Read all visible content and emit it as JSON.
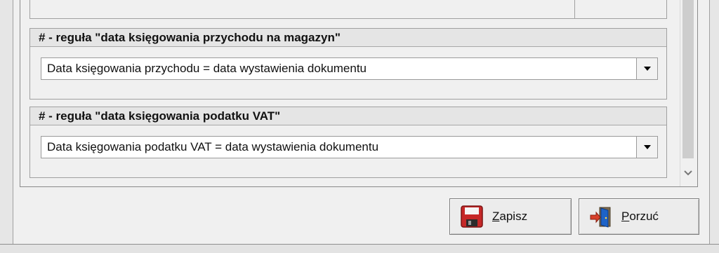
{
  "rule_groups": [
    {
      "title": "# - reguła \"data księgowania przychodu na magazyn\"",
      "selected_value": "Data księgowania przychodu = data wystawienia dokumentu"
    },
    {
      "title": "# - reguła \"data księgowania podatku VAT\"",
      "selected_value": "Data księgowania podatku VAT = data wystawienia dokumentu"
    }
  ],
  "buttons": {
    "save": {
      "mnemonic": "Z",
      "rest": "apisz",
      "icon": "floppy-disk-icon"
    },
    "quit": {
      "mnemonic": "P",
      "rest": "orzuć",
      "icon": "exit-door-icon"
    }
  },
  "colors": {
    "floppy_red": "#c62828",
    "door_blue": "#1e63c8",
    "arrow_red": "#d7402a"
  }
}
